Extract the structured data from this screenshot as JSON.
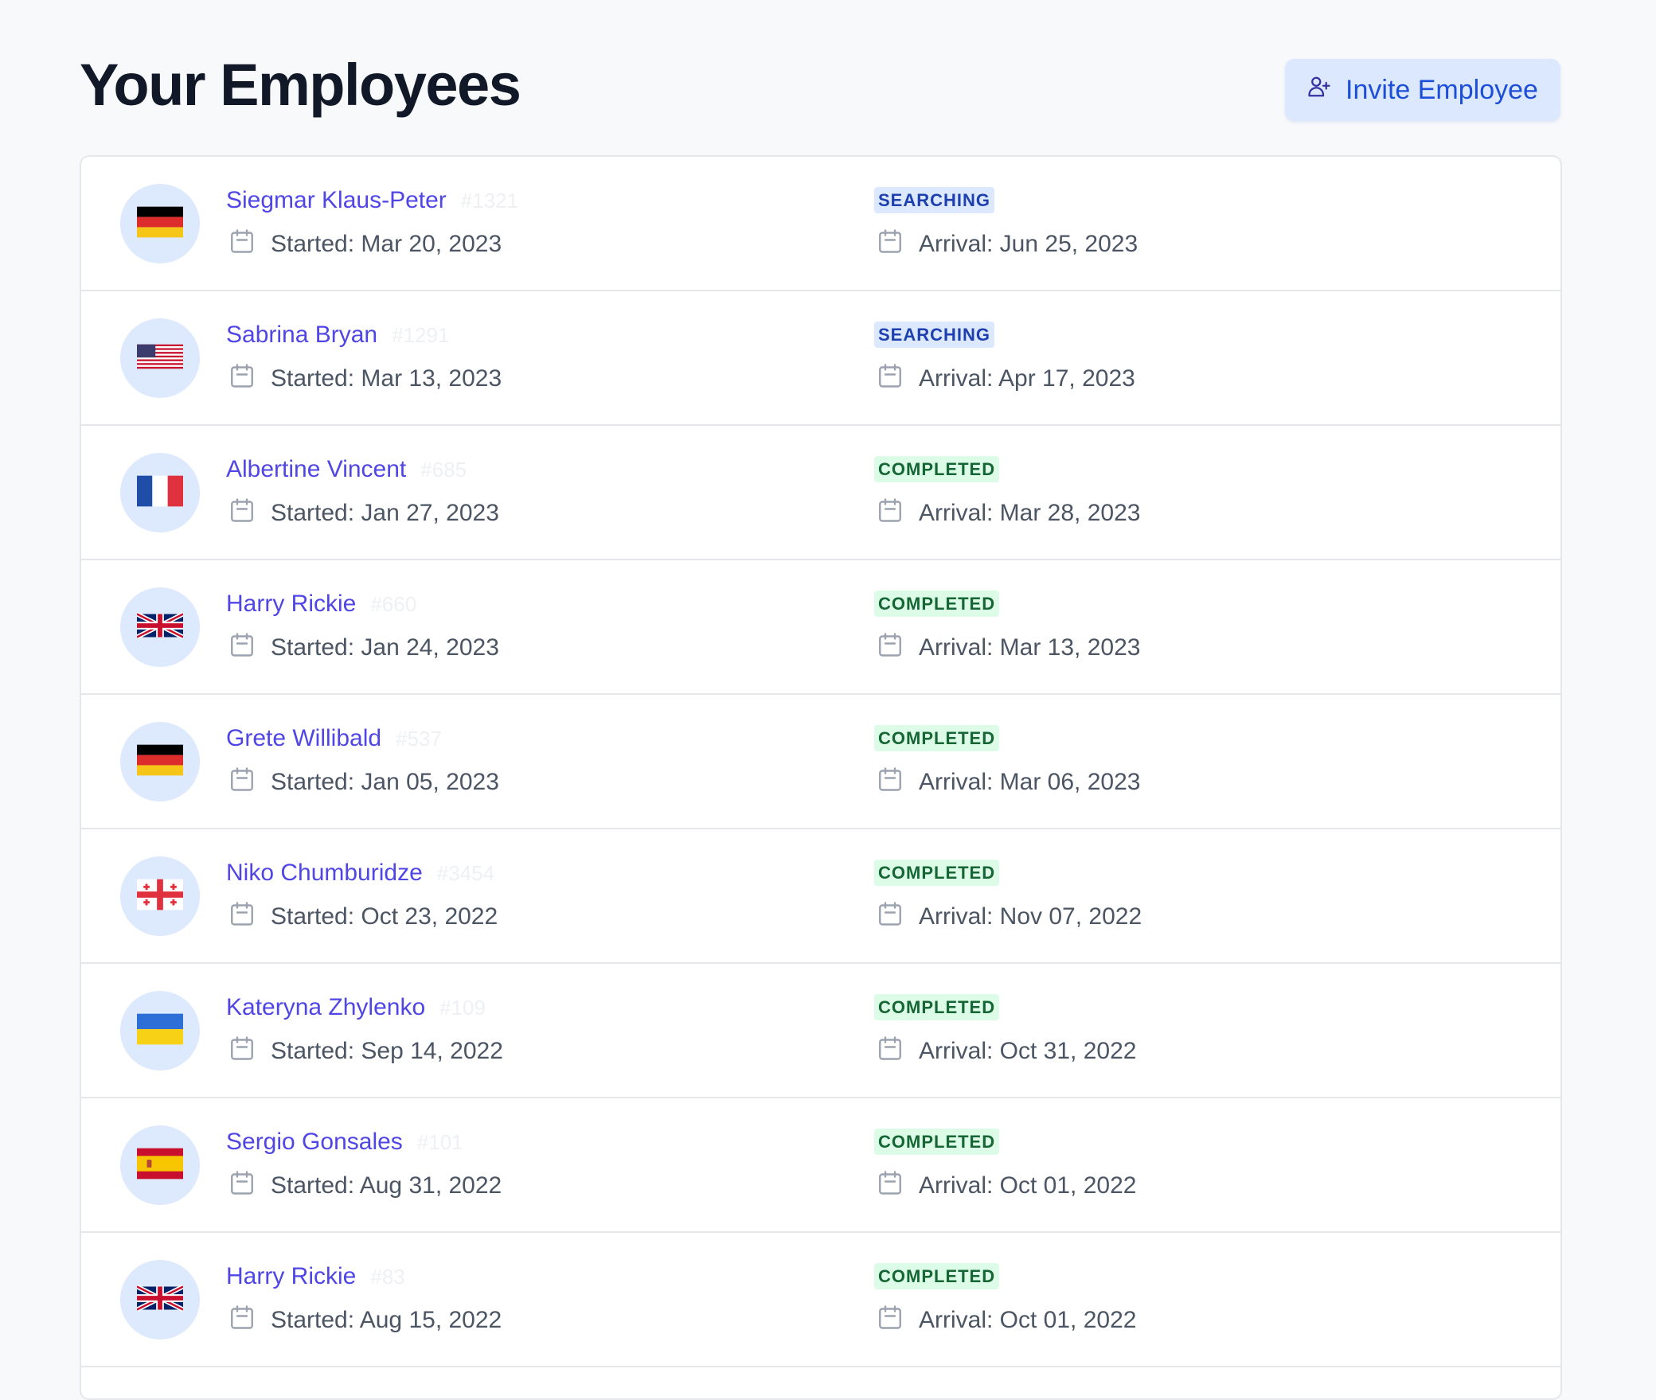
{
  "page": {
    "title": "Your Employees",
    "invite_button_label": "Invite Employee",
    "invite_icon": "user-plus-icon"
  },
  "status_colors": {
    "SEARCHING": {
      "bg": "#dbe8fd",
      "fg": "#1e40af"
    },
    "COMPLETED": {
      "bg": "#dcfce7",
      "fg": "#166534"
    }
  },
  "employees": [
    {
      "name": "Siegmar Klaus-Peter",
      "id": "#1321",
      "flag": "germany",
      "started": "Started: Mar 20, 2023",
      "status": "SEARCHING",
      "arrival": "Arrival: Jun 25, 2023"
    },
    {
      "name": "Sabrina Bryan",
      "id": "#1291",
      "flag": "usa",
      "started": "Started: Mar 13, 2023",
      "status": "SEARCHING",
      "arrival": "Arrival: Apr 17, 2023"
    },
    {
      "name": "Albertine Vincent",
      "id": "#685",
      "flag": "france",
      "started": "Started: Jan 27, 2023",
      "status": "COMPLETED",
      "arrival": "Arrival: Mar 28, 2023"
    },
    {
      "name": "Harry Rickie",
      "id": "#660",
      "flag": "uk",
      "started": "Started: Jan 24, 2023",
      "status": "COMPLETED",
      "arrival": "Arrival: Mar 13, 2023"
    },
    {
      "name": "Grete Willibald",
      "id": "#537",
      "flag": "germany",
      "started": "Started: Jan 05, 2023",
      "status": "COMPLETED",
      "arrival": "Arrival: Mar 06, 2023"
    },
    {
      "name": "Niko Chumburidze",
      "id": "#3454",
      "flag": "georgia",
      "started": "Started: Oct 23, 2022",
      "status": "COMPLETED",
      "arrival": "Arrival: Nov 07, 2022"
    },
    {
      "name": "Kateryna Zhylenko",
      "id": "#109",
      "flag": "ukraine",
      "started": "Started: Sep 14, 2022",
      "status": "COMPLETED",
      "arrival": "Arrival: Oct 31, 2022"
    },
    {
      "name": "Sergio Gonsales",
      "id": "#101",
      "flag": "spain",
      "started": "Started: Aug 31, 2022",
      "status": "COMPLETED",
      "arrival": "Arrival: Oct 01, 2022"
    },
    {
      "name": "Harry Rickie",
      "id": "#83",
      "flag": "uk",
      "started": "Started: Aug 15, 2022",
      "status": "COMPLETED",
      "arrival": "Arrival: Oct 01, 2022"
    }
  ]
}
